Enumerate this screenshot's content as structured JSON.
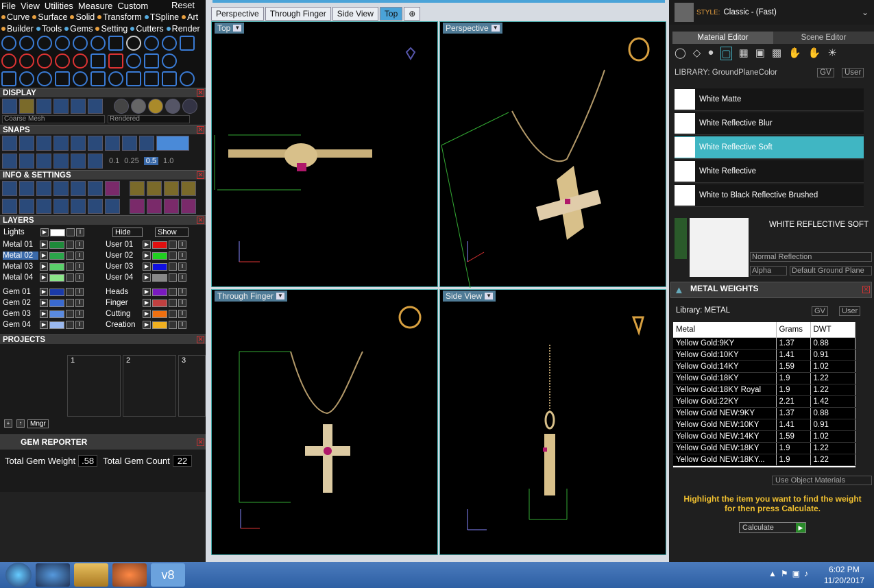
{
  "menu": {
    "items": [
      "File",
      "View",
      "Utilities",
      "Measure",
      "Custom"
    ],
    "reset": "Reset"
  },
  "submenu1": [
    "Curve",
    "Surface",
    "Solid",
    "Transform",
    "TSpline",
    "Art"
  ],
  "submenu2": [
    "Builder",
    "Tools",
    "Gems",
    "Setting",
    "Cutters",
    "Render"
  ],
  "display": {
    "title": "DISPLAY",
    "mesh": "Coarse Mesh",
    "render": "Rendered"
  },
  "snaps": {
    "title": "SNAPS",
    "values": [
      "0.1",
      "0.25",
      "0.5",
      "1.0"
    ]
  },
  "info": {
    "title": "INFO & SETTINGS"
  },
  "layers": {
    "title": "LAYERS",
    "lights": "Lights",
    "hide": "Hide",
    "show": "Show",
    "left": [
      {
        "name": "Metal 01",
        "color": "#1e8a3a"
      },
      {
        "name": "Metal 02",
        "color": "#2aa64a"
      },
      {
        "name": "Metal 03",
        "color": "#5acf6a"
      },
      {
        "name": "Metal 04",
        "color": "#8ce68a"
      },
      {
        "name": "Gem 01",
        "color": "#1a3aa8"
      },
      {
        "name": "Gem 02",
        "color": "#3a6ad0"
      },
      {
        "name": "Gem 03",
        "color": "#5a8ae0"
      },
      {
        "name": "Gem 04",
        "color": "#9ab8ee"
      }
    ],
    "right": [
      {
        "name": "User 01",
        "color": "#e01010"
      },
      {
        "name": "User 02",
        "color": "#20d020"
      },
      {
        "name": "User 03",
        "color": "#1010e0"
      },
      {
        "name": "User 04",
        "color": "#888888"
      },
      {
        "name": "Heads",
        "color": "#7a1ac0"
      },
      {
        "name": "Finger",
        "color": "#c04040"
      },
      {
        "name": "Cutting",
        "color": "#f07010"
      },
      {
        "name": "Creation",
        "color": "#f0b020"
      }
    ]
  },
  "projects": {
    "title": "PROJECTS",
    "slots": [
      "1",
      "2",
      "3"
    ],
    "mngr": "Mngr"
  },
  "gem_reporter": {
    "title": "GEM REPORTER",
    "weight_label": "Total Gem Weight",
    "weight": ".58",
    "count_label": "Total Gem Count",
    "count": "22"
  },
  "viewports": {
    "tabs": [
      "Perspective",
      "Through Finger",
      "Side View",
      "Top"
    ],
    "active_tab": "Top",
    "top": "Top",
    "perspective": "Perspective",
    "through_finger": "Through Finger",
    "side_view": "Side View"
  },
  "style": {
    "label": "STYLE:",
    "value": "Classic - (Fast)"
  },
  "editor_tabs": {
    "material": "Material Editor",
    "scene": "Scene Editor"
  },
  "library": {
    "label": "LIBRARY: GroundPlaneColor",
    "gv": "GV",
    "user": "User"
  },
  "materials": [
    {
      "name": "White Matte"
    },
    {
      "name": "White Reflective Blur"
    },
    {
      "name": "White Reflective Soft",
      "selected": true
    },
    {
      "name": "White Reflective"
    },
    {
      "name": "White to Black Reflective Brushed"
    }
  ],
  "material_preview": {
    "name": "WHITE REFLECTIVE SOFT",
    "reflection": "Normal Reflection",
    "alpha": "Alpha",
    "ground": "Default Ground Plane"
  },
  "metal_weights": {
    "title": "METAL WEIGHTS",
    "library": "Library: METAL",
    "gv": "GV",
    "user": "User",
    "headers": [
      "Metal",
      "Grams",
      "DWT"
    ],
    "rows": [
      [
        "Yellow Gold:9KY",
        "1.37",
        "0.88"
      ],
      [
        "Yellow Gold:10KY",
        "1.41",
        "0.91"
      ],
      [
        "Yellow Gold:14KY",
        "1.59",
        "1.02"
      ],
      [
        "Yellow Gold:18KY",
        "1.9",
        "1.22"
      ],
      [
        "Yellow Gold:18KY Royal",
        "1.9",
        "1.22"
      ],
      [
        "Yellow Gold:22KY",
        "2.21",
        "1.42"
      ],
      [
        "Yellow Gold NEW:9KY",
        "1.37",
        "0.88"
      ],
      [
        "Yellow Gold NEW:10KY",
        "1.41",
        "0.91"
      ],
      [
        "Yellow Gold NEW:14KY",
        "1.59",
        "1.02"
      ],
      [
        "Yellow Gold NEW:18KY",
        "1.9",
        "1.22"
      ],
      [
        "Yellow Gold NEW:18KY...",
        "1.9",
        "1.22"
      ]
    ],
    "use_object": "Use Object Materials",
    "hint": "Highlight the item you want to find the weight for then press Calculate.",
    "calculate": "Calculate"
  },
  "taskbar": {
    "time": "6:02 PM",
    "date": "11/20/2017",
    "app_label": "v8"
  }
}
